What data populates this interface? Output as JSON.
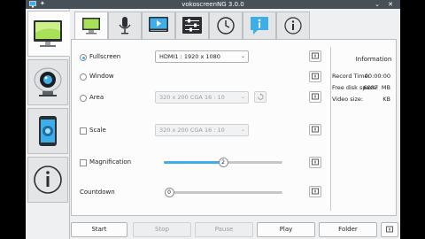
{
  "window": {
    "title": "vokoscreenNG 3.0.0"
  },
  "sidebar": {
    "tabs": [
      {
        "icon": "monitor-icon"
      },
      {
        "icon": "webcam-icon"
      },
      {
        "icon": "magnifier-phone-icon"
      },
      {
        "icon": "info-icon"
      }
    ]
  },
  "toptabs": [
    {
      "icon": "monitor-icon"
    },
    {
      "icon": "microphone-icon"
    },
    {
      "icon": "video-player-icon"
    },
    {
      "icon": "sliders-icon"
    },
    {
      "icon": "clock-icon"
    },
    {
      "icon": "chat-info-icon"
    },
    {
      "icon": "info-icon"
    }
  ],
  "screen": {
    "fullscreen_label": "Fullscreen",
    "fullscreen_value": "HDMI1 :  1920 x 1080",
    "window_label": "Window",
    "area_label": "Area",
    "area_value": "320 x 200 CGA 16 : 10",
    "scale_label": "Scale",
    "scale_value": "320 x 200 CGA 16 : 10",
    "magnification_label": "Magnification",
    "magnification_value": "2",
    "magnification_level": 0.5,
    "countdown_label": "Countdown",
    "countdown_value": "0",
    "countdown_level": 0.0
  },
  "info": {
    "title": "Information",
    "record_time_label": "Record Time:",
    "record_time_value": "00:00:00",
    "free_disk_label": "Free disk space:",
    "free_disk_value": "6087",
    "free_disk_unit": "MB",
    "video_size_label": "Video size:",
    "video_size_unit": "KB"
  },
  "bottom": {
    "start_label": "Start",
    "stop_label": "Stop",
    "pause_label": "Pause",
    "play_label": "Play",
    "folder_label": "Folder"
  },
  "colors": {
    "accent": "#3daee9",
    "titlebar": "#475057"
  }
}
